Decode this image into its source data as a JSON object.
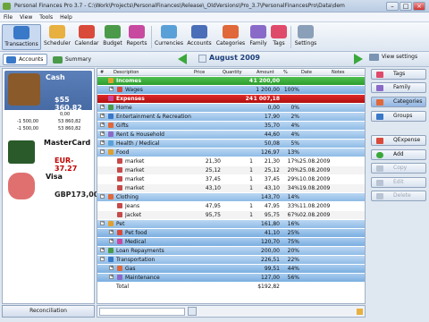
{
  "window": {
    "title": "Personal Finances Pro 3.7 - C:\\Work\\Projects\\PersonalFinances\\Release\\_OldVersions\\Pro_3.7\\PersonalFinancesPro\\Data\\demo_eng..."
  },
  "menu": [
    "File",
    "View",
    "Tools",
    "Help"
  ],
  "toolbar": [
    "Transactions",
    "Scheduler",
    "Calendar",
    "Budget",
    "Reports",
    "Currencies",
    "Accounts",
    "Categories",
    "Family",
    "Tags",
    "Settings"
  ],
  "subbar": {
    "accounts": "Accounts",
    "summary": "Summary",
    "month": "August 2009",
    "view_settings": "View settings"
  },
  "accounts": [
    {
      "name": "Cash",
      "balance": "$55 360,82",
      "color": "#7b4a1e",
      "lines": [
        {
          "a": "",
          "b": "0,00"
        },
        {
          "a": "-1 500,00",
          "b": "53 860,82"
        },
        {
          "a": "-1 500,00",
          "b": "53 860,82"
        }
      ]
    },
    {
      "name": "MasterCard",
      "balance": "EUR-37,27",
      "color": "#c00000"
    },
    {
      "name": "Visa",
      "balance": "GBP173,00",
      "color": "#222222"
    }
  ],
  "reconciliation": "Reconciliation",
  "columns": [
    "#",
    "Description",
    "Price",
    "Quantity",
    "Amount",
    "%",
    "Date",
    "Notes"
  ],
  "rows": [
    {
      "t": "inc",
      "desc": "Incomes",
      "qty": "4",
      "amt": "1 200,00"
    },
    {
      "t": "sub",
      "desc": "Wages",
      "amt": "1 200,00",
      "pct": "100%",
      "ind": 1
    },
    {
      "t": "exp",
      "desc": "Expenses",
      "qty": "24",
      "amt": "1 007,18"
    },
    {
      "t": "cat",
      "desc": "Home",
      "amt": "0,00",
      "pct": "0%"
    },
    {
      "t": "cat",
      "desc": "Entertainment & Recreation",
      "amt": "17,90",
      "pct": "2%"
    },
    {
      "t": "cat",
      "desc": "Gifts",
      "amt": "35,70",
      "pct": "4%"
    },
    {
      "t": "cat",
      "desc": "Rent & Household",
      "amt": "44,60",
      "pct": "4%"
    },
    {
      "t": "cat",
      "desc": "Health / Medical",
      "amt": "50,08",
      "pct": "5%"
    },
    {
      "t": "cat",
      "desc": "Food",
      "amt": "126,97",
      "pct": "13%",
      "open": true
    },
    {
      "t": "tx",
      "desc": "market",
      "price": "21,30",
      "qty": "1",
      "amt": "21,30",
      "pct": "17%",
      "date": "25.08.2009"
    },
    {
      "t": "tx2",
      "desc": "market",
      "price": "25,12",
      "qty": "1",
      "amt": "25,12",
      "pct": "20%",
      "date": "25.08.2009"
    },
    {
      "t": "tx",
      "desc": "market",
      "price": "37,45",
      "qty": "1",
      "amt": "37,45",
      "pct": "29%",
      "date": "10.08.2009"
    },
    {
      "t": "tx2",
      "desc": "market",
      "price": "43,10",
      "qty": "1",
      "amt": "43,10",
      "pct": "34%",
      "date": "19.08.2009"
    },
    {
      "t": "cat",
      "desc": "Clothing",
      "amt": "143,70",
      "pct": "14%",
      "open": true
    },
    {
      "t": "tx",
      "desc": "Jeans",
      "price": "47,95",
      "qty": "1",
      "amt": "47,95",
      "pct": "33%",
      "date": "11.08.2009"
    },
    {
      "t": "tx2",
      "desc": "Jacket",
      "price": "95,75",
      "qty": "1",
      "amt": "95,75",
      "pct": "67%",
      "date": "02.08.2009"
    },
    {
      "t": "cat",
      "desc": "Pet",
      "amt": "161,80",
      "pct": "16%",
      "open": true
    },
    {
      "t": "sub",
      "desc": "Pet food",
      "amt": "41,10",
      "pct": "25%",
      "ind": 1
    },
    {
      "t": "sub",
      "desc": "Medical",
      "amt": "120,70",
      "pct": "75%",
      "ind": 1
    },
    {
      "t": "cat",
      "desc": "Loan Repayments",
      "amt": "200,00",
      "pct": "20%"
    },
    {
      "t": "cat",
      "desc": "Transportation",
      "amt": "226,51",
      "pct": "22%",
      "open": true
    },
    {
      "t": "sub",
      "desc": "Gas",
      "amt": "99,51",
      "pct": "44%",
      "ind": 1
    },
    {
      "t": "sub",
      "desc": "Maintenance",
      "amt": "127,00",
      "pct": "56%",
      "ind": 1
    },
    {
      "t": "tot",
      "desc": "Total",
      "amt": "$192,82"
    }
  ],
  "right_panel": {
    "buttons": [
      "Tags",
      "Family",
      "Categories",
      "Groups"
    ],
    "actions": [
      "QExpense",
      "Add",
      "Copy",
      "Edit",
      "Delete"
    ]
  }
}
